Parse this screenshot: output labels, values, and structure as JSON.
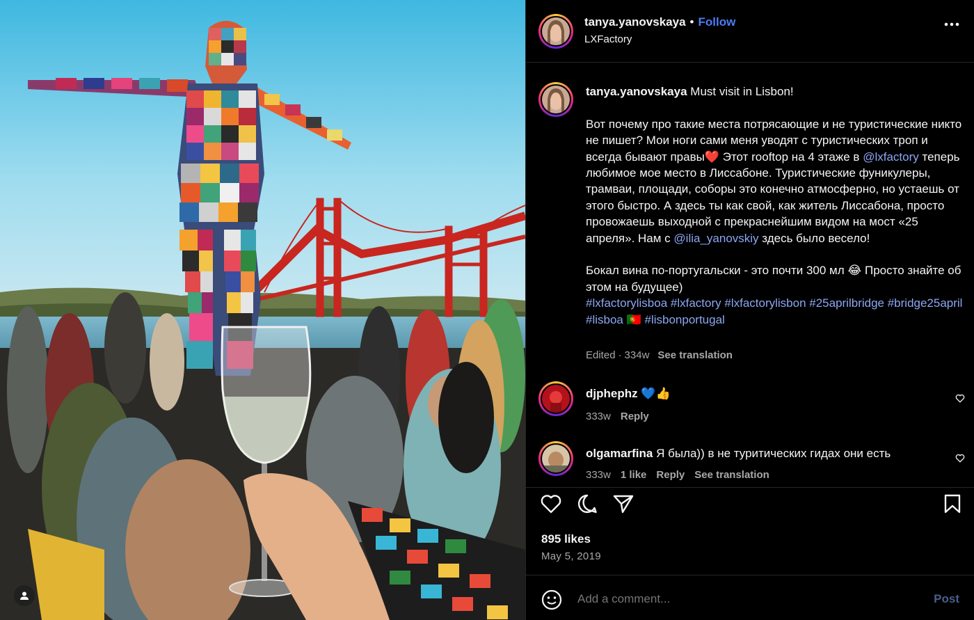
{
  "post": {
    "author": "tanya.yanovskaya",
    "follow_label": "Follow",
    "separator": "•",
    "location": "LXFactory",
    "more_icon": "more-horizontal-icon"
  },
  "caption": {
    "author": "tanya.yanovskaya",
    "headline": "Must visit in Lisbon!",
    "para1_a": "Вот почему про такие места потрясающие и не туристические никто не пишет? Мои ноги сами меня уводят с туристических троп и всегда бывают правы",
    "heart_emoji": "❤️",
    "para1_b": " Этот rooftop на 4 этаже в ",
    "mention1": "@lxfactory",
    "para1_c": " теперь любимое мое место в Лиссабоне. Туристические фуникулеры, трамваи, площади, соборы это конечно атмосферно, но устаешь от этого быстро. А здесь ты как свой, как житель Лиссабона, просто провожаешь выходной с прекраснейшим видом на мост «25 апреля». Нам с ",
    "mention2": "@ilia_yanovskiy",
    "para1_d": " здесь было весело!",
    "para2_a": "Бокал вина по-португальски - это почти 300 мл ",
    "laugh_emoji": "😂",
    "para2_b": " Просто знайте об этом на будущее)",
    "hashtags_a": "#lxfactorylisboa #lxfactory #lxfactorylisbon #25aprilbridge #bridge25april #lisboa",
    "flag_emoji": "🇵🇹",
    "hashtags_b": " #lisbonportugal",
    "edited": "Edited",
    "dot": "·",
    "age": "334w",
    "see_translation": "See translation"
  },
  "comments": [
    {
      "user": "djphephz",
      "text": "💙👍",
      "age": "333w",
      "reply": "Reply"
    },
    {
      "user": "olgamarfina",
      "text": "Я была)) в не туритических гидах они есть",
      "age": "333w",
      "likes": "1 like",
      "reply": "Reply",
      "see_translation": "See translation"
    }
  ],
  "actions": {
    "like_icon": "heart-icon",
    "comment_icon": "comment-icon",
    "share_icon": "send-icon",
    "save_icon": "bookmark-icon"
  },
  "stats": {
    "likes": "895 likes",
    "date": "May 5, 2019"
  },
  "add_comment": {
    "placeholder": "Add a comment...",
    "post_label": "Post"
  },
  "colors": {
    "follow": "#4c7cf6",
    "link": "#8ca7f2",
    "muted": "#a8a8a8",
    "background": "#000000"
  }
}
